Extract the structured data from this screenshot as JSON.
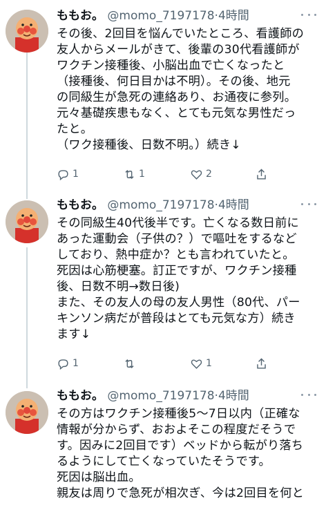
{
  "tweets": [
    {
      "name": "ももお。",
      "handle": "@momo_7197178",
      "separator": "·",
      "time": "4時間",
      "text": "その後、2回目を悩んでいたところ、看護師の\n友人からメールがきて、後輩の30代看護師が\nワクチン接種後、小脳出血で亡くなったと\n（接種後、何日目かは不明）。その後、地元\nの同級生が急死の連絡あり、お通夜に参列。\n元々基礎疾患もなく、とても元気な男性だっ\nたと。\n（ワク接種後、日数不明。）続き↓",
      "replies": "1",
      "retweets": "1",
      "likes": "2"
    },
    {
      "name": "ももお。",
      "handle": "@momo_7197178",
      "separator": "·",
      "time": "4時間",
      "text": "その同級生40代後半です。亡くなる数日前に\nあった運動会（子供の？）で嘔吐をするなど\nしており、熱中症か？とも言われていたと。\n死因は心筋梗塞。訂正ですが、ワクチン接種\n後、日数不明→数日後)\nまた、その友人の母の友人男性（80代、パー\nキンソン病だが普段はとても元気な方）続き\nます↓",
      "replies": "1",
      "retweets": "",
      "likes": "1"
    },
    {
      "name": "ももお。",
      "handle": "@momo_7197178",
      "separator": "·",
      "time": "4時間",
      "text": "その方はワクチン接種後5〜7日以内（正確な\n情報が分からず、おおよそこの程度だそうで\nす。因みに2回目です）ベッドから転がり落ち\nるようにして亡くなっていたそうです。\n死因は脳出血。\n親友は周りで急死が相次ぎ、今は2回目を何と"
    }
  ],
  "icons": {
    "reply": "reply-icon",
    "retweet": "retweet-icon",
    "like": "heart-icon",
    "share": "share-icon",
    "more": "more-icon"
  },
  "colors": {
    "name": "#0f1419",
    "secondary": "#536471",
    "thread_line": "#cfd9de"
  }
}
